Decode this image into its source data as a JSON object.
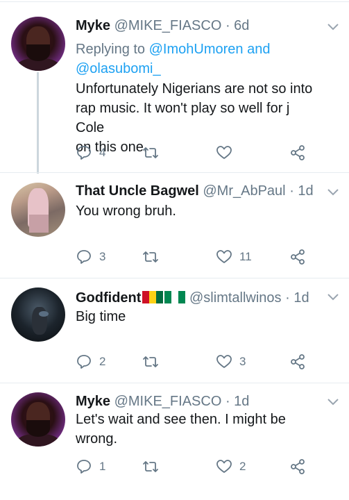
{
  "tweets": [
    {
      "name": "Myke",
      "handle": "@MIKE_FIASCO",
      "time": "· 6d",
      "replying_prefix": "Replying to",
      "replying_mention1": "@ImohUmoren and",
      "replying_mention2": "@olasubomi_",
      "text_lines": [
        "Unfortunately Nigerians are not so into",
        "rap music. It won't play so well for j Cole",
        "on this one."
      ],
      "replies": "4",
      "retweets": "",
      "likes": ""
    },
    {
      "name": "That Uncle Bagwel",
      "handle": "@Mr_AbPaul",
      "time": "· 1d",
      "text_lines": [
        "You wrong bruh."
      ],
      "replies": "3",
      "retweets": "",
      "likes": "11"
    },
    {
      "name": "Godfident",
      "handle": "@slimtallwinos",
      "time": "· 1d",
      "text_lines": [
        "Big time"
      ],
      "replies": "2",
      "retweets": "",
      "likes": "3"
    },
    {
      "name": "Myke",
      "handle": "@MIKE_FIASCO",
      "time": "· 1d",
      "text_lines": [
        "Let's wait and see then. I might be",
        "wrong."
      ],
      "replies": "1",
      "retweets": "",
      "likes": "2"
    }
  ],
  "icons": {
    "reply": "reply-icon",
    "retweet": "retweet-icon",
    "like": "heart-icon",
    "share": "share-icon",
    "more": "chevron-down-icon"
  },
  "colors": {
    "link": "#1da1f2",
    "meta": "#657786",
    "icon": "#657786",
    "thread_line": "#ccd6dd"
  }
}
